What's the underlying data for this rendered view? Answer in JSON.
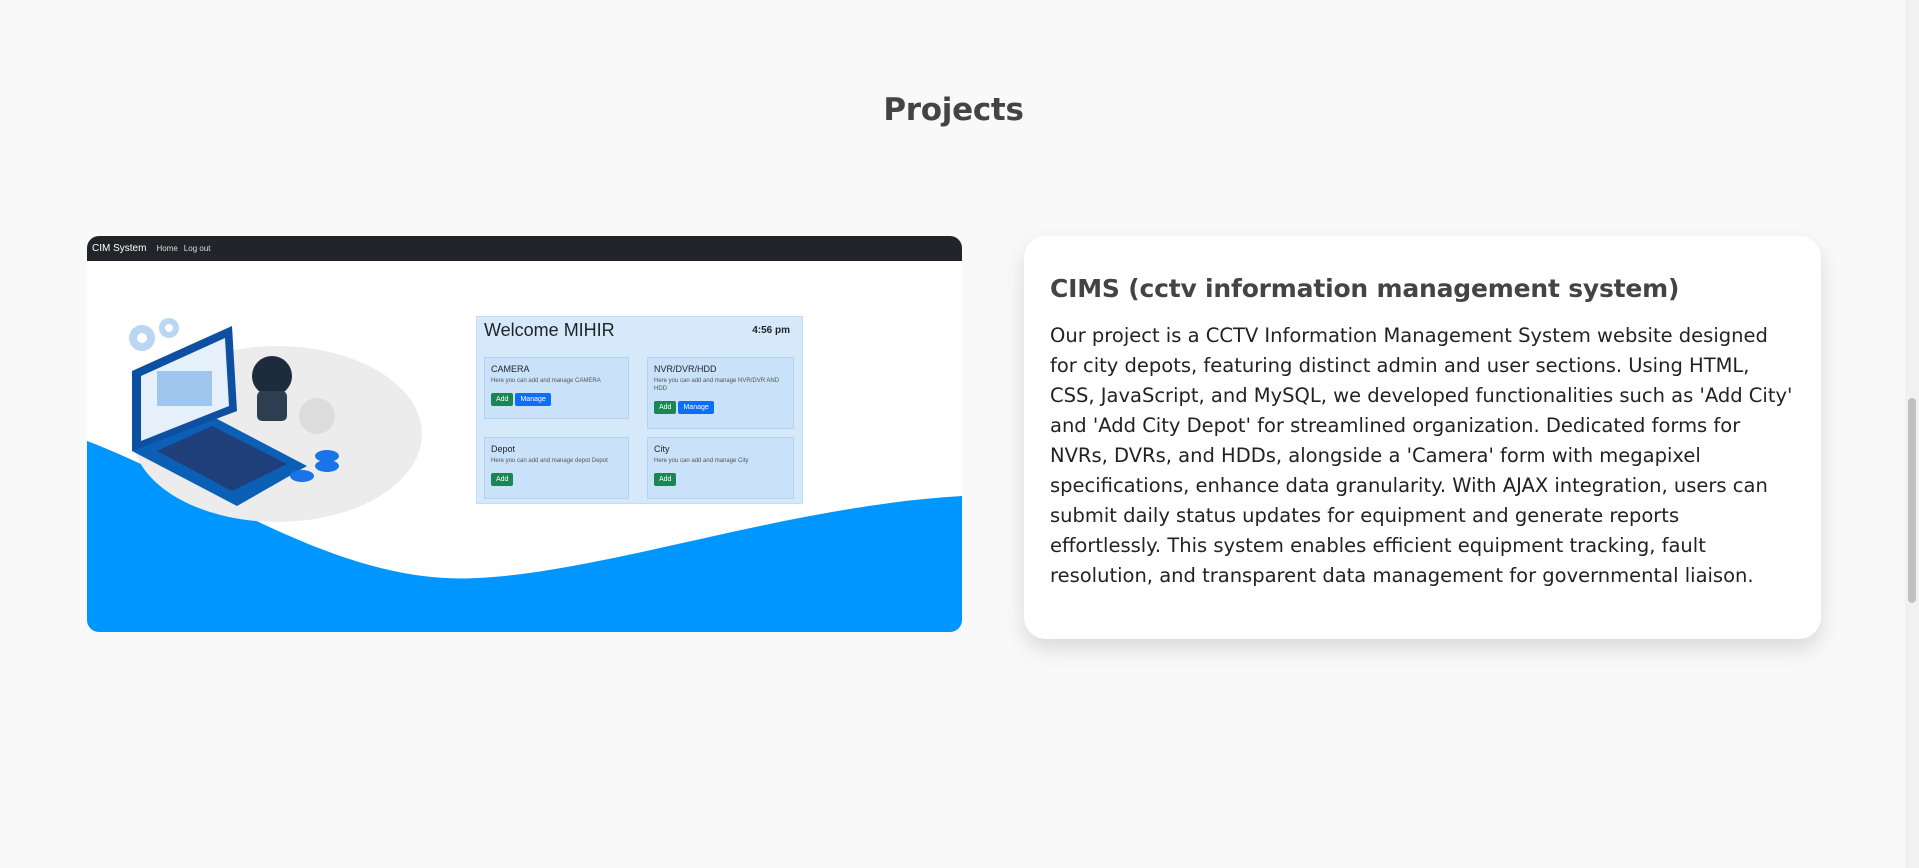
{
  "section": {
    "title": "Projects"
  },
  "project": {
    "screenshot": {
      "nav": {
        "brand": "CIM System",
        "links": [
          "Home",
          "Log out"
        ]
      },
      "welcome": "Welcome MIHIR",
      "time": "4:56 pm",
      "modules": [
        {
          "name": "CAMERA",
          "description": "Here you can add and manage CAMERA",
          "buttons": [
            "Add",
            "Manage"
          ]
        },
        {
          "name": "NVR/DVR/HDD",
          "description": "Here you can add and manage NVR/DVR AND HDD",
          "buttons": [
            "Add",
            "Manage"
          ]
        },
        {
          "name": "Depot",
          "description": "Here you can add and manage depot Depot",
          "buttons": [
            "Add"
          ]
        },
        {
          "name": "City",
          "description": "Here you can add and manage City",
          "buttons": [
            "Add"
          ]
        }
      ],
      "accent_color": "#0096ff"
    },
    "title": "CIMS (cctv information management system)",
    "description": "Our project is a CCTV Information Management System website designed for city depots, featuring distinct admin and user sections. Using HTML, CSS, JavaScript, and MySQL, we developed functionalities such as 'Add City' and 'Add City Depot' for streamlined organization. Dedicated forms for NVRs, DVRs, and HDDs, alongside a 'Camera' form with megapixel specifications, enhance data granularity. With AJAX integration, users can submit daily status updates for equipment and generate reports effortlessly. This system enables efficient equipment tracking, fault resolution, and transparent data management for governmental liaison."
  }
}
